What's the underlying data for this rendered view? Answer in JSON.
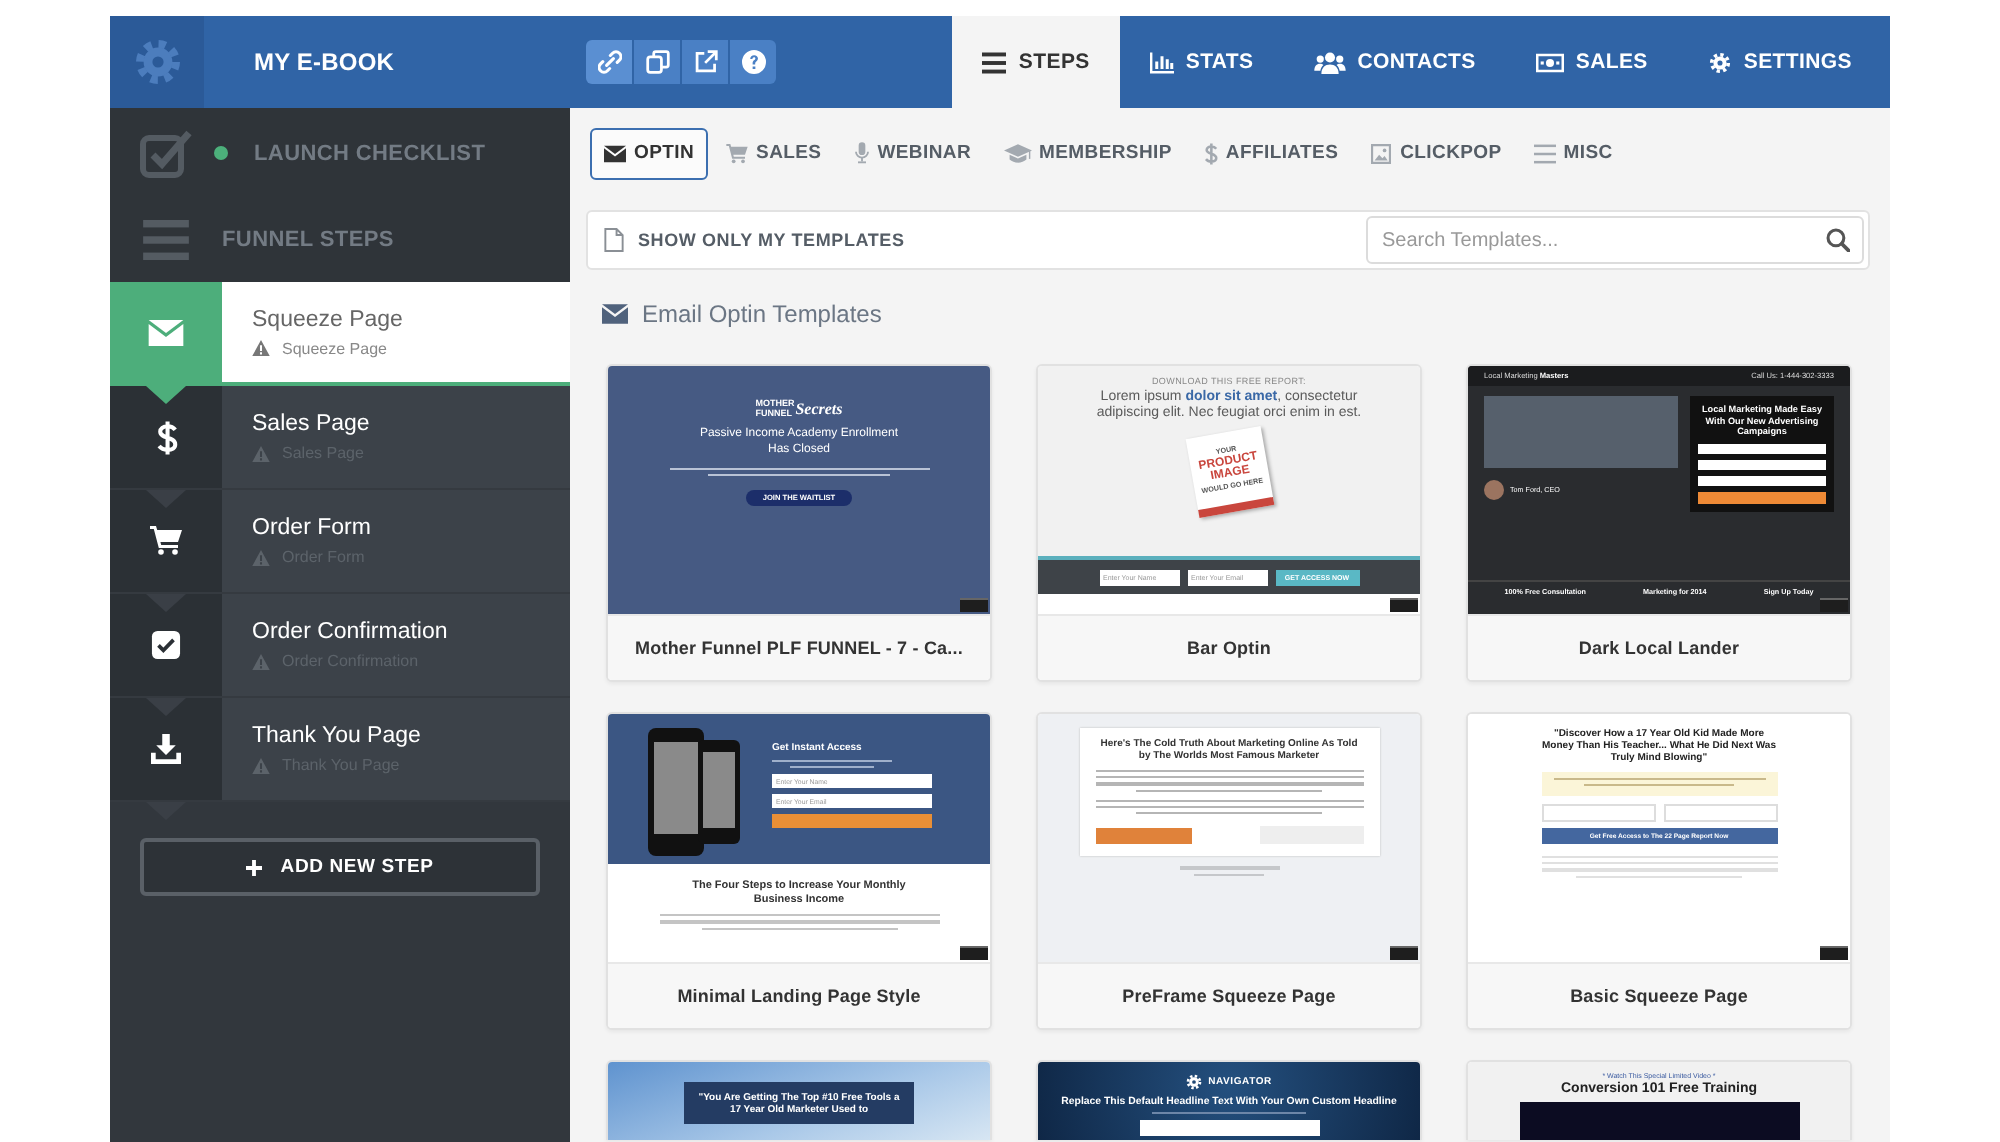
{
  "header": {
    "title": "MY E-BOOK"
  },
  "main_tabs": [
    {
      "label": "STEPS",
      "selected": true
    },
    {
      "label": "STATS",
      "selected": false
    },
    {
      "label": "CONTACTS",
      "selected": false
    },
    {
      "label": "SALES",
      "selected": false
    },
    {
      "label": "SETTINGS",
      "selected": false
    }
  ],
  "sidebar": {
    "checklist": {
      "label": "LAUNCH CHECKLIST"
    },
    "section": {
      "label": "FUNNEL STEPS"
    },
    "steps": [
      {
        "title": "Squeeze Page",
        "subtitle": "Squeeze Page",
        "selected": true
      },
      {
        "title": "Sales Page",
        "subtitle": "Sales Page",
        "selected": false
      },
      {
        "title": "Order Form",
        "subtitle": "Order Form",
        "selected": false
      },
      {
        "title": "Order Confirmation",
        "subtitle": "Order Confirmation",
        "selected": false
      },
      {
        "title": "Thank You Page",
        "subtitle": "Thank You Page",
        "selected": false
      }
    ],
    "add_button": "ADD NEW STEP"
  },
  "category_tabs": [
    {
      "label": "OPTIN",
      "selected": true
    },
    {
      "label": "SALES",
      "selected": false
    },
    {
      "label": "WEBINAR",
      "selected": false
    },
    {
      "label": "MEMBERSHIP",
      "selected": false
    },
    {
      "label": "AFFILIATES",
      "selected": false
    },
    {
      "label": "CLICKPOP",
      "selected": false
    },
    {
      "label": "MISC",
      "selected": false
    }
  ],
  "filter": {
    "toggle_label": "SHOW ONLY MY TEMPLATES",
    "search": {
      "placeholder": "Search Templates..."
    }
  },
  "section_title": "Email Optin Templates",
  "templates": [
    {
      "title": "Mother Funnel PLF FUNNEL - 7 - Ca...",
      "preview": {
        "kind": "notice",
        "logo": "MOTHER FUNNEL",
        "logo_script": "Secrets",
        "headline": "Passive Income Academy Enrollment Has Closed",
        "button": "JOIN THE WAITLIST"
      }
    },
    {
      "title": "Bar Optin",
      "preview": {
        "kind": "bar-optin",
        "kicker": "DOWNLOAD THIS FREE REPORT:",
        "headline": "Lorem ipsum **dolor sit amet**, consectetur adipiscing elit. Nec feugiat orci enim in est.",
        "book": [
          "YOUR",
          "PRODUCT IMAGE",
          "WOULD GO HERE"
        ],
        "fields": [
          "Enter Your Name",
          "Enter Your Email"
        ],
        "button": "GET ACCESS NOW"
      }
    },
    {
      "title": "Dark Local Lander",
      "preview": {
        "kind": "dark-lander",
        "brand": "Local Marketing **Masters**",
        "phone": "Call Us: 1-444-302-3333",
        "headline": "Local Marketing Made Easy With Our New Advertising Campaigns",
        "person": "Tom Ford, CEO",
        "features": [
          "100% Free Consultation",
          "Marketing for 2014",
          "Sign Up Today"
        ]
      }
    },
    {
      "title": "Minimal Landing Page Style",
      "preview": {
        "kind": "phone-hero",
        "cta_title": "Get Instant Access",
        "fields": [
          "Enter Your Name",
          "Enter Your Email"
        ],
        "headline": "The Four Steps to Increase Your Monthly Business Income"
      }
    },
    {
      "title": "PreFrame Squeeze Page",
      "preview": {
        "kind": "letter",
        "headline": "Here's The Cold Truth About Marketing Online As Told by The Worlds Most Famous Marketer"
      }
    },
    {
      "title": "Basic Squeeze Page",
      "preview": {
        "kind": "squeeze",
        "headline": "\"Discover How a 17 Year Old Kid Made More Money Than His Teacher... What He Did Next Was Truly Mind Blowing\"",
        "button": "Get Free Access to The 22 Page Report Now"
      }
    },
    {
      "preview": {
        "kind": "sky",
        "headline": "\"You Are Getting The Top #10 Free Tools a 17 Year Old Marketer Used to"
      }
    },
    {
      "preview": {
        "kind": "navigator",
        "logo": "NAVIGATOR",
        "headline": "Replace This Default Headline Text With Your Own Custom Headline"
      }
    },
    {
      "preview": {
        "kind": "video",
        "kicker": "* Watch This Special Limited Video *",
        "headline": "Conversion 101 Free Training"
      }
    }
  ]
}
